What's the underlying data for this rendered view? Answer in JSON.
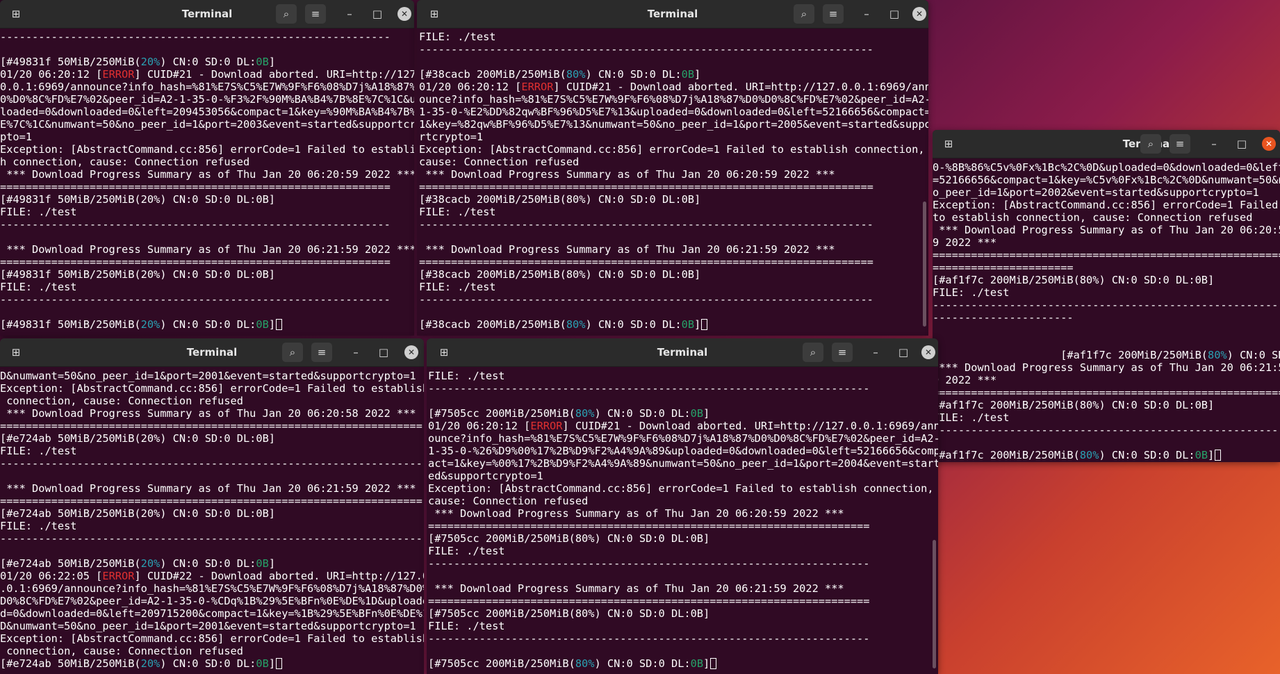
{
  "windows": {
    "tl": {
      "title": "Terminal",
      "lines": [
        [
          {
            "t": "-------------------------------------------------------------"
          }
        ],
        [
          {
            "t": ""
          }
        ],
        [
          {
            "t": "[#49831f 50MiB/250MiB("
          },
          {
            "t": "20%",
            "c": "pct"
          },
          {
            "t": ") CN:0 SD:0 DL:"
          },
          {
            "t": "0B",
            "c": "dl"
          },
          {
            "t": "]"
          }
        ],
        [
          {
            "t": "01/20 06:20:12 ["
          },
          {
            "t": "ERROR",
            "c": "err"
          },
          {
            "t": "] CUID#21 - Download aborted. URI=http://127."
          }
        ],
        [
          {
            "t": "0.0.1:6969/announce?info_hash=%81%E7S%C5%E7W%9F%F6%08%D7j%A18%87%D"
          }
        ],
        [
          {
            "t": "0%D0%8C%FD%E7%02&peer_id=A2-1-35-0-%F3%2F%90M%BA%B4%7B%8E%7C%1C&up"
          }
        ],
        [
          {
            "t": "loaded=0&downloaded=0&left=209453056&compact=1&key=%90M%BA%B4%7B%8"
          }
        ],
        [
          {
            "t": "E%7C%1C&numwant=50&no_peer_id=1&port=2003&event=started&supportcry"
          }
        ],
        [
          {
            "t": "pto=1"
          }
        ],
        [
          {
            "t": "Exception: [AbstractCommand.cc:856] errorCode=1 Failed to establis"
          }
        ],
        [
          {
            "t": "h connection, cause: Connection refused"
          }
        ],
        [
          {
            "t": " *** Download Progress Summary as of Thu Jan 20 06:20:59 2022 ***"
          }
        ],
        [
          {
            "t": "============================================================="
          }
        ],
        [
          {
            "t": "[#49831f 50MiB/250MiB(20%) CN:0 SD:0 DL:0B]"
          }
        ],
        [
          {
            "t": "FILE: ./test"
          }
        ],
        [
          {
            "t": "-------------------------------------------------------------"
          }
        ],
        [
          {
            "t": ""
          }
        ],
        [
          {
            "t": " *** Download Progress Summary as of Thu Jan 20 06:21:59 2022 ***"
          }
        ],
        [
          {
            "t": "============================================================="
          }
        ],
        [
          {
            "t": "[#49831f 50MiB/250MiB(20%) CN:0 SD:0 DL:0B]"
          }
        ],
        [
          {
            "t": "FILE: ./test"
          }
        ],
        [
          {
            "t": "-------------------------------------------------------------"
          }
        ],
        [
          {
            "t": ""
          }
        ],
        [
          {
            "t": "[#49831f 50MiB/250MiB("
          },
          {
            "t": "20%",
            "c": "pct"
          },
          {
            "t": ") CN:0 SD:0 DL:"
          },
          {
            "t": "0B",
            "c": "dl"
          },
          {
            "t": "]"
          },
          {
            "cursor": true
          }
        ]
      ]
    },
    "tm": {
      "title": "Terminal",
      "lines": [
        [
          {
            "t": "FILE: ./test"
          }
        ],
        [
          {
            "t": "-----------------------------------------------------------------------"
          }
        ],
        [
          {
            "t": ""
          }
        ],
        [
          {
            "t": "[#38cacb 200MiB/250MiB("
          },
          {
            "t": "80%",
            "c": "pct"
          },
          {
            "t": ") CN:0 SD:0 DL:"
          },
          {
            "t": "0B",
            "c": "dl"
          },
          {
            "t": "]"
          }
        ],
        [
          {
            "t": "01/20 06:20:12 ["
          },
          {
            "t": "ERROR",
            "c": "err"
          },
          {
            "t": "] CUID#21 - Download aborted. URI=http://127.0.0.1:6969/ann"
          }
        ],
        [
          {
            "t": "ounce?info_hash=%81%E7S%C5%E7W%9F%F6%08%D7j%A18%87%D0%D0%8C%FD%E7%02&peer_id=A2-"
          }
        ],
        [
          {
            "t": "1-35-0-%E2%DD%82qw%BF%96%D5%E7%13&uploaded=0&downloaded=0&left=52166656&compact="
          }
        ],
        [
          {
            "t": "1&key=%82qw%BF%96%D5%E7%13&numwant=50&no_peer_id=1&port=2005&event=started&suppo"
          }
        ],
        [
          {
            "t": "rtcrypto=1"
          }
        ],
        [
          {
            "t": "Exception: [AbstractCommand.cc:856] errorCode=1 Failed to establish connection,"
          }
        ],
        [
          {
            "t": "cause: Connection refused"
          }
        ],
        [
          {
            "t": " *** Download Progress Summary as of Thu Jan 20 06:20:59 2022 ***"
          }
        ],
        [
          {
            "t": "======================================================================="
          }
        ],
        [
          {
            "t": "[#38cacb 200MiB/250MiB(80%) CN:0 SD:0 DL:0B]"
          }
        ],
        [
          {
            "t": "FILE: ./test"
          }
        ],
        [
          {
            "t": "-----------------------------------------------------------------------"
          }
        ],
        [
          {
            "t": ""
          }
        ],
        [
          {
            "t": " *** Download Progress Summary as of Thu Jan 20 06:21:59 2022 ***"
          }
        ],
        [
          {
            "t": "======================================================================="
          }
        ],
        [
          {
            "t": "[#38cacb 200MiB/250MiB(80%) CN:0 SD:0 DL:0B]"
          }
        ],
        [
          {
            "t": "FILE: ./test"
          }
        ],
        [
          {
            "t": "-----------------------------------------------------------------------"
          }
        ],
        [
          {
            "t": ""
          }
        ],
        [
          {
            "t": "[#38cacb 200MiB/250MiB("
          },
          {
            "t": "80%",
            "c": "pct"
          },
          {
            "t": ") CN:0 SD:0 DL:"
          },
          {
            "t": "0B",
            "c": "dl"
          },
          {
            "t": "]"
          },
          {
            "cursor": true
          }
        ]
      ]
    },
    "r": {
      "title": "Terminal",
      "lines": [
        [
          {
            "t": "0-%8B%86%C5v%0Fx%1Bc%2C%0D&uploaded=0&downloaded=0&left"
          }
        ],
        [
          {
            "t": "=52166656&compact=1&key=%C5v%0Fx%1Bc%2C%0D&numwant=50&n"
          }
        ],
        [
          {
            "t": "o_peer_id=1&port=2002&event=started&supportcrypto=1"
          }
        ],
        [
          {
            "t": "Exception: [AbstractCommand.cc:856] errorCode=1 Failed"
          }
        ],
        [
          {
            "t": "to establish connection, cause: Connection refused"
          }
        ],
        [
          {
            "t": " *** Download Progress Summary as of Thu Jan 20 06:20:5"
          }
        ],
        [
          {
            "t": "9 2022 ***"
          }
        ],
        [
          {
            "t": "======================================================="
          }
        ],
        [
          {
            "t": "======================"
          }
        ],
        [
          {
            "t": "[#af1f7c 200MiB/250MiB(80%) CN:0 SD:0 DL:0B]"
          }
        ],
        [
          {
            "t": "FILE: ./test"
          }
        ],
        [
          {
            "t": "-------------------------------------------------------"
          }
        ],
        [
          {
            "t": "----------------------"
          }
        ],
        [
          {
            "t": ""
          }
        ],
        [
          {
            "t": ""
          }
        ],
        [
          {
            "t": "                    [#af1f7c 200MiB/250MiB("
          },
          {
            "t": "80%",
            "c": "pct"
          },
          {
            "t": ") CN:0 SD"
          }
        ],
        [
          {
            "t": " *** Download Progress Summary as of Thu Jan 20 06:21:5"
          }
        ],
        [
          {
            "t": "9 2022 ***"
          }
        ],
        [
          {
            "t": "======================================================="
          }
        ],
        [
          {
            "t": "[#af1f7c 200MiB/250MiB(80%) CN:0 SD:0 DL:0B]"
          }
        ],
        [
          {
            "t": "FILE: ./test"
          }
        ],
        [
          {
            "t": "-------------------------------------------------------"
          }
        ],
        [
          {
            "t": ""
          }
        ],
        [
          {
            "t": "[#af1f7c 200MiB/250MiB("
          },
          {
            "t": "80%",
            "c": "pct"
          },
          {
            "t": ") CN:0 SD:0 DL:"
          },
          {
            "t": "0B",
            "c": "dl"
          },
          {
            "t": "]"
          },
          {
            "cursor": true
          }
        ]
      ]
    },
    "bl": {
      "title": "Terminal",
      "lines": [
        [
          {
            "t": "D&numwant=50&no_peer_id=1&port=2001&event=started&supportcrypto=1"
          }
        ],
        [
          {
            "t": "Exception: [AbstractCommand.cc:856] errorCode=1 Failed to establish"
          }
        ],
        [
          {
            "t": " connection, cause: Connection refused"
          }
        ],
        [
          {
            "t": " *** Download Progress Summary as of Thu Jan 20 06:20:58 2022 ***"
          }
        ],
        [
          {
            "t": "=================================================================="
          }
        ],
        [
          {
            "t": "[#e724ab 50MiB/250MiB(20%) CN:0 SD:0 DL:0B]"
          }
        ],
        [
          {
            "t": "FILE: ./test"
          }
        ],
        [
          {
            "t": "------------------------------------------------------------------"
          }
        ],
        [
          {
            "t": ""
          }
        ],
        [
          {
            "t": " *** Download Progress Summary as of Thu Jan 20 06:21:59 2022 ***"
          }
        ],
        [
          {
            "t": "=================================================================="
          }
        ],
        [
          {
            "t": "[#e724ab 50MiB/250MiB(20%) CN:0 SD:0 DL:0B]"
          }
        ],
        [
          {
            "t": "FILE: ./test"
          }
        ],
        [
          {
            "t": "------------------------------------------------------------------"
          }
        ],
        [
          {
            "t": ""
          }
        ],
        [
          {
            "t": "[#e724ab 50MiB/250MiB("
          },
          {
            "t": "20%",
            "c": "pct"
          },
          {
            "t": ") CN:0 SD:0 DL:"
          },
          {
            "t": "0B",
            "c": "dl"
          },
          {
            "t": "]"
          }
        ],
        [
          {
            "t": "01/20 06:22:05 ["
          },
          {
            "t": "ERROR",
            "c": "err"
          },
          {
            "t": "] CUID#22 - Download aborted. URI=http://127.0"
          }
        ],
        [
          {
            "t": ".0.1:6969/announce?info_hash=%81%E7S%C5%E7W%9F%F6%08%D7j%A18%87%D0%"
          }
        ],
        [
          {
            "t": "D0%8C%FD%E7%02&peer_id=A2-1-35-0-%CDq%1B%29%5E%BFn%0E%DE%1D&uploade"
          }
        ],
        [
          {
            "t": "d=0&downloaded=0&left=209715200&compact=1&key=%1B%29%5E%BFn%0E%DE%1"
          }
        ],
        [
          {
            "t": "D&numwant=50&no_peer_id=1&port=2001&event=started&supportcrypto=1"
          }
        ],
        [
          {
            "t": "Exception: [AbstractCommand.cc:856] errorCode=1 Failed to establish"
          }
        ],
        [
          {
            "t": " connection, cause: Connection refused"
          }
        ],
        [
          {
            "t": "[#e724ab 50MiB/250MiB("
          },
          {
            "t": "20%",
            "c": "pct"
          },
          {
            "t": ") CN:0 SD:0 DL:"
          },
          {
            "t": "0B",
            "c": "dl"
          },
          {
            "t": "]"
          },
          {
            "cursor": true
          }
        ]
      ]
    },
    "bm": {
      "title": "Terminal",
      "lines": [
        [
          {
            "t": "FILE: ./test"
          }
        ],
        [
          {
            "t": "---------------------------------------------------------------------"
          }
        ],
        [
          {
            "t": ""
          }
        ],
        [
          {
            "t": "[#7505cc 200MiB/250MiB("
          },
          {
            "t": "80%",
            "c": "pct"
          },
          {
            "t": ") CN:0 SD:0 DL:"
          },
          {
            "t": "0B",
            "c": "dl"
          },
          {
            "t": "]"
          }
        ],
        [
          {
            "t": "01/20 06:20:12 ["
          },
          {
            "t": "ERROR",
            "c": "err"
          },
          {
            "t": "] CUID#21 - Download aborted. URI=http://127.0.0.1:6969/ann"
          }
        ],
        [
          {
            "t": "ounce?info_hash=%81%E7S%C5%E7W%9F%F6%08%D7j%A18%87%D0%D0%8C%FD%E7%02&peer_id=A2-"
          }
        ],
        [
          {
            "t": "1-35-0-%26%D9%00%17%2B%D9%F2%A4%9A%89&uploaded=0&downloaded=0&left=52166656&comp"
          }
        ],
        [
          {
            "t": "act=1&key=%00%17%2B%D9%F2%A4%9A%89&numwant=50&no_peer_id=1&port=2004&event=start"
          }
        ],
        [
          {
            "t": "ed&supportcrypto=1"
          }
        ],
        [
          {
            "t": "Exception: [AbstractCommand.cc:856] errorCode=1 Failed to establish connection,"
          }
        ],
        [
          {
            "t": "cause: Connection refused"
          }
        ],
        [
          {
            "t": " *** Download Progress Summary as of Thu Jan 20 06:20:59 2022 ***"
          }
        ],
        [
          {
            "t": "====================================================================="
          }
        ],
        [
          {
            "t": "[#7505cc 200MiB/250MiB(80%) CN:0 SD:0 DL:0B]"
          }
        ],
        [
          {
            "t": "FILE: ./test"
          }
        ],
        [
          {
            "t": "---------------------------------------------------------------------"
          }
        ],
        [
          {
            "t": ""
          }
        ],
        [
          {
            "t": " *** Download Progress Summary as of Thu Jan 20 06:21:59 2022 ***"
          }
        ],
        [
          {
            "t": "====================================================================="
          }
        ],
        [
          {
            "t": "[#7505cc 200MiB/250MiB(80%) CN:0 SD:0 DL:0B]"
          }
        ],
        [
          {
            "t": "FILE: ./test"
          }
        ],
        [
          {
            "t": "---------------------------------------------------------------------"
          }
        ],
        [
          {
            "t": ""
          }
        ],
        [
          {
            "t": "[#7505cc 200MiB/250MiB("
          },
          {
            "t": "80%",
            "c": "pct"
          },
          {
            "t": ") CN:0 SD:0 DL:"
          },
          {
            "t": "0B",
            "c": "dl"
          },
          {
            "t": "]"
          },
          {
            "cursor": true
          }
        ]
      ]
    }
  },
  "icons": {
    "new_tab": "new-tab-icon",
    "search": "search-icon",
    "menu": "hamburger-menu-icon",
    "minimize": "minimize-icon",
    "maximize": "maximize-icon",
    "close": "close-icon"
  },
  "glyphs": {
    "new_tab": "⊞",
    "search": "⌕",
    "menu": "≡",
    "minimize": "–",
    "maximize": "□",
    "close": "✕"
  },
  "colors": {
    "terminal_bg": "#300a24",
    "error": "#e03030",
    "percent": "#2aa1b3",
    "download": "#26a269",
    "accent_close": "#e95420"
  }
}
